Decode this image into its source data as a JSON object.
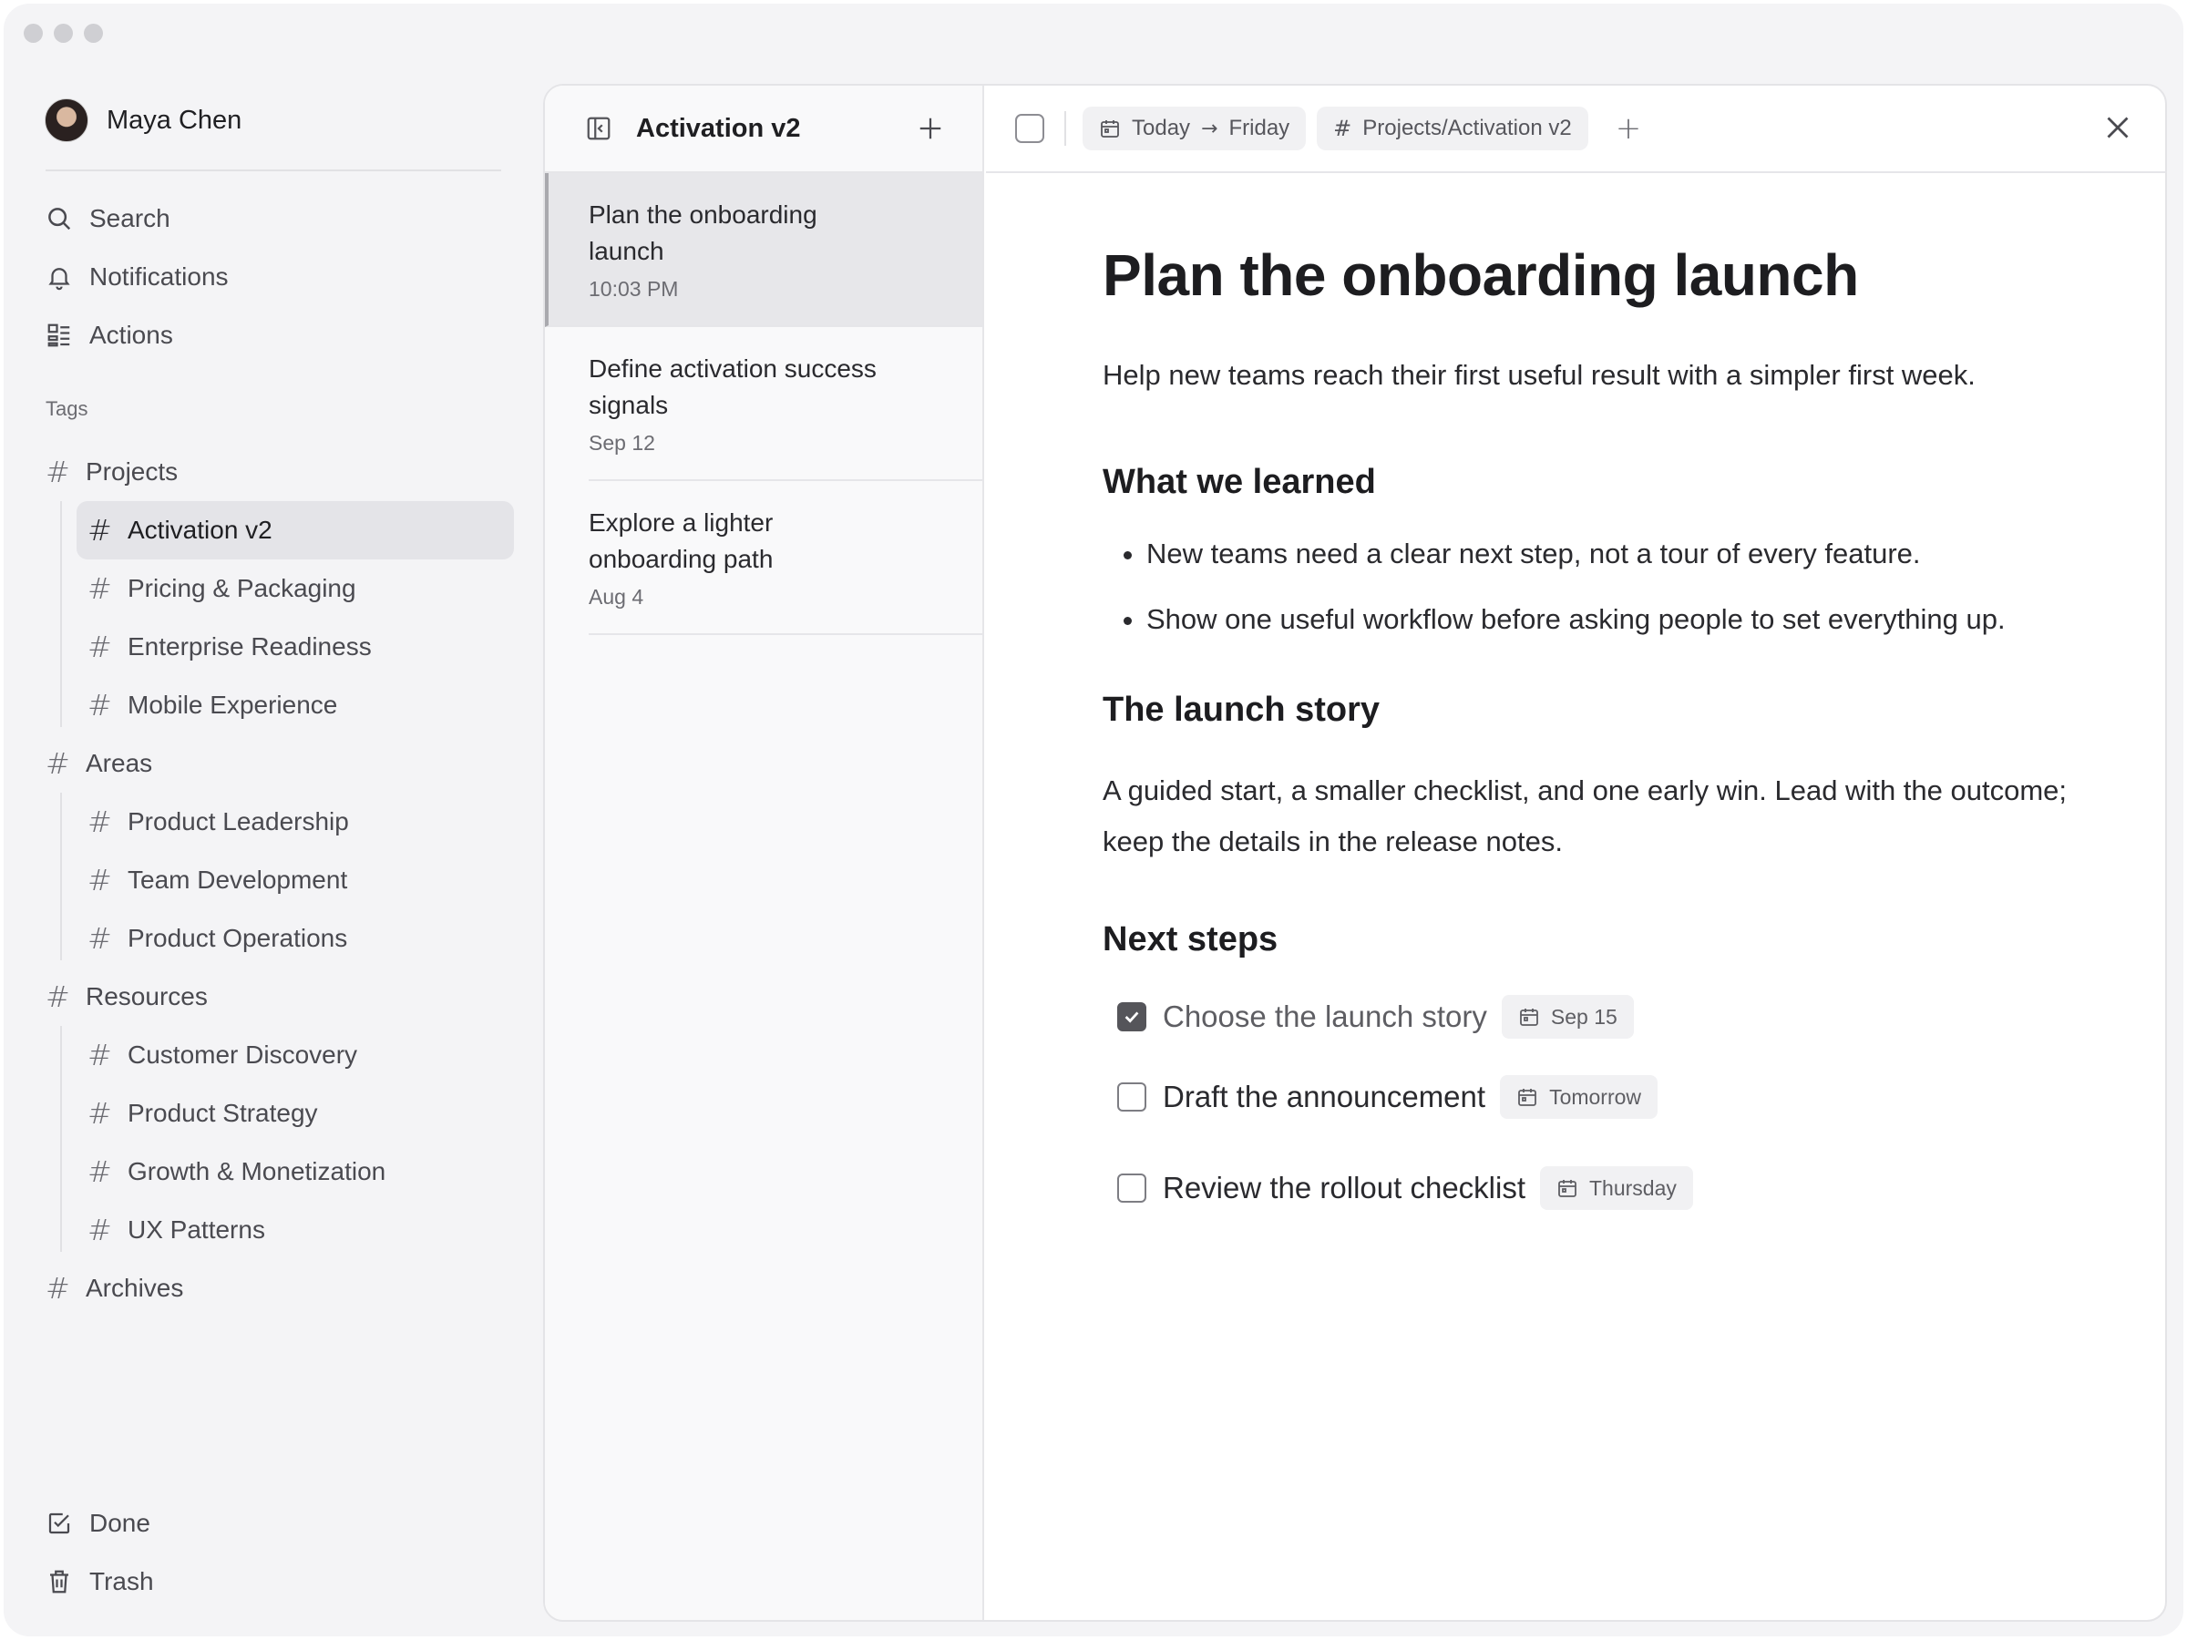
{
  "profile": {
    "name": "Maya Chen"
  },
  "nav": {
    "search": "Search",
    "notifications": "Notifications",
    "actions": "Actions",
    "tags_label": "Tags",
    "done": "Done",
    "trash": "Trash"
  },
  "tags": {
    "projects": {
      "label": "Projects",
      "children": [
        "Activation v2",
        "Pricing & Packaging",
        "Enterprise Readiness",
        "Mobile Experience"
      ]
    },
    "areas": {
      "label": "Areas",
      "children": [
        "Product Leadership",
        "Team Development",
        "Product Operations"
      ]
    },
    "resources": {
      "label": "Resources",
      "children": [
        "Customer Discovery",
        "Product Strategy",
        "Growth & Monetization",
        "UX Patterns"
      ]
    },
    "archives": {
      "label": "Archives"
    },
    "hash_symbol": "#"
  },
  "list": {
    "title": "Activation v2",
    "notes": [
      {
        "title": "Plan the onboarding launch",
        "date": "10:03 PM"
      },
      {
        "title": "Define activation success signals",
        "date": "Sep 12"
      },
      {
        "title": "Explore a lighter onboarding path",
        "date": "Aug 4"
      }
    ]
  },
  "toolbar": {
    "date_from": "Today",
    "date_arrow": "→",
    "date_to": "Friday",
    "tag_path": "Projects/Activation v2",
    "add": "+"
  },
  "doc": {
    "title": "Plan the onboarding launch",
    "lead": "Help new teams reach their first useful result with a simpler first week.",
    "section1_heading": "What we learned",
    "bullets": [
      "New teams need a clear next step, not a tour of every feature.",
      "Show one useful workflow before asking people to set everything up."
    ],
    "section2_heading": "The launch story",
    "section2_body": "A guided start, a smaller checklist, and one early win. Lead with the outcome; keep the details in the release notes.",
    "section3_heading": "Next steps",
    "tasks": [
      {
        "label": "Choose the launch story",
        "date": "Sep 15",
        "done": true
      },
      {
        "label": "Draft the announcement",
        "date": "Tomorrow",
        "done": false
      },
      {
        "label": "Review the rollout checklist",
        "date": "Thursday",
        "done": false
      }
    ]
  },
  "icons": [
    "search-icon",
    "bell-icon",
    "actions-icon",
    "hash-icon",
    "check-square-icon",
    "trash-icon",
    "sidebar-toggle-icon",
    "plus-icon",
    "calendar-icon",
    "close-icon",
    "checkmark-icon"
  ]
}
